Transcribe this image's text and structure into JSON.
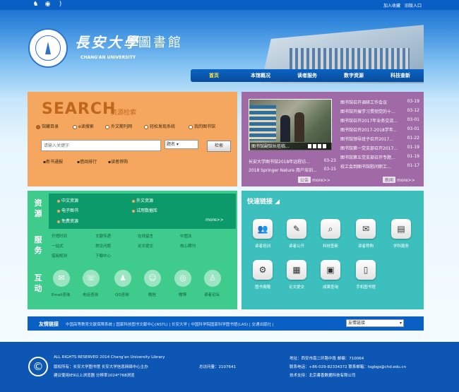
{
  "topbar": {
    "links": [
      "加入收藏",
      "旧版入口"
    ]
  },
  "header": {
    "title_a": "長安大學",
    "title_b": "圖書館",
    "subtitle_en": "CHANG'AN UNIVERSITY"
  },
  "nav": [
    {
      "label": "首页"
    },
    {
      "label": "本馆概况"
    },
    {
      "label": "读者服务"
    },
    {
      "label": "数字资源"
    },
    {
      "label": "科技查新"
    }
  ],
  "search": {
    "title": "SEARCH",
    "subtitle": "资源检索",
    "tabs": [
      "馆藏目录",
      "e读搜索",
      "外文期刊网",
      "轻松发现系统",
      "我的图书馆"
    ],
    "placeholder": "请输入关键字",
    "select_value": "题名",
    "button": "检索",
    "links": [
      "新书通报",
      "借阅排行",
      "读者荐购"
    ]
  },
  "news": {
    "photo_caption": "图书馆副馆长莅临...",
    "right_items": [
      {
        "title": "图书馆召开调研工作会议",
        "date": "03-19"
      },
      {
        "title": "图书馆开展学习贯彻党的十...",
        "date": "03-12"
      },
      {
        "title": "图书馆召开2017年业务交流...",
        "date": "03-01"
      },
      {
        "title": "图书馆召开2017-2018学年...",
        "date": "03-01"
      },
      {
        "title": "图书馆领导班子召开2017...",
        "date": "01-22"
      },
      {
        "title": "图书馆第一党支部召开2017...",
        "date": "01-19"
      },
      {
        "title": "图书馆第五党支部召开专题...",
        "date": "01-19"
      },
      {
        "title": "校工会到图书馆慰问职工...",
        "date": "01-17"
      }
    ],
    "left_items": [
      {
        "title": "长安大学图书馆2018年远程访...",
        "date": "03-23"
      },
      {
        "title": "2018 Springer Nature 用户培训...",
        "date": "03-15"
      }
    ],
    "more_left": {
      "tag": "公告",
      "text": "more>>"
    },
    "more_right": {
      "tag": "新闻",
      "text": "more>>"
    }
  },
  "resources": {
    "label_res": [
      "资",
      "源"
    ],
    "label_svc": [
      "服",
      "务"
    ],
    "label_int": [
      "互",
      "动"
    ],
    "links": [
      "中文资源",
      "外文资源",
      "电子图书",
      "试用数据库",
      "免费资源"
    ],
    "more": "more>>",
    "services": [
      "开馆时间",
      "文献传递",
      "在线留言",
      "中图法",
      "一站式",
      "常见问题",
      "论文提交",
      "核心期刊",
      "借阅规则",
      "下载中心"
    ],
    "interact": [
      "Email咨询",
      "电话咨询",
      "QQ咨询",
      "微信",
      "微博",
      "读者论坛"
    ]
  },
  "quick": {
    "title": "快速链接",
    "items": [
      "读者培训",
      "读者公开",
      "科技查新",
      "读者荐购",
      "学科服务",
      "图书捐赠",
      "论文提交",
      "成果查询",
      "手机图书馆"
    ]
  },
  "links_bar": {
    "label": "友情链接",
    "text": "中国高等教育文献保障系统  |  国家科技图书文献中心(NSTL)  |  长安大学  |  中国科学院国家科学图书馆(LAS)  |  交通出版社  |",
    "select_value": "友情链接"
  },
  "footer": {
    "copyright_symbol": "©",
    "rights": "ALL RIGHTS RESERVED  2014 Chang'an University Library",
    "owner": "版权所有：长安大学图书馆  长安大学信息网络中心主办",
    "browser": "建议使用IE9以上浏览器  分辨率1024*768浏览",
    "visits": "总访问量：2107641",
    "address": "地址：西安市南二环路中段   邮编：710064",
    "phone": "联系电话：+86-029-82334372   联系邮箱：tsgbgs@chd.edu.cn",
    "support": "技术支持：北京書香数据科技有限公司"
  }
}
